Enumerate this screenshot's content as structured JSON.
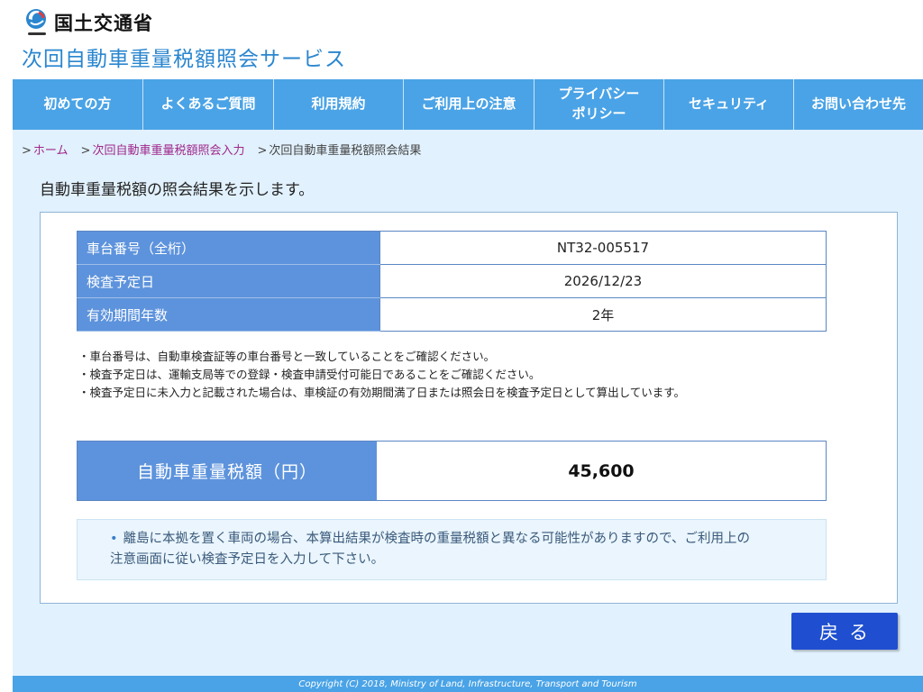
{
  "header": {
    "ministry_name": "国土交通省",
    "logo_icon": "mlit-logo-icon",
    "service_title": "次回自動車重量税額照会サービス"
  },
  "nav": {
    "items": [
      {
        "label": "初めての方"
      },
      {
        "label": "よくあるご質問"
      },
      {
        "label": "利用規約"
      },
      {
        "label": "ご利用上の注意"
      },
      {
        "label": "プライバシー\nポリシー"
      },
      {
        "label": "セキュリティ"
      },
      {
        "label": "お問い合わせ先"
      }
    ]
  },
  "breadcrumb": {
    "sep": ">",
    "home": "ホーム",
    "input": "次回自動車重量税額照会入力",
    "current": "次回自動車重量税額照会結果"
  },
  "lead": "自動車重量税額の照会結果を示します。",
  "info": {
    "rows": [
      {
        "label": "車台番号（全桁）",
        "value": "NT32-005517"
      },
      {
        "label": "検査予定日",
        "value": "2026/12/23"
      },
      {
        "label": "有効期間年数",
        "value": "2年"
      }
    ]
  },
  "notes": [
    "・車台番号は、自動車検査証等の車台番号と一致していることをご確認ください。",
    "・検査予定日は、運輸支局等での登録・検査申請受付可能日であることをご確認ください。",
    "・検査予定日に未入力と記載された場合は、車検証の有効期間満了日または照会日を検査予定日として算出しています。"
  ],
  "tax": {
    "label": "自動車重量税額（円）",
    "value": "45,600"
  },
  "notice": {
    "bullet": "•",
    "line1": "離島に本拠を置く車両の場合、本算出結果が検査時の重量税額と異なる可能性がありますので、ご利用上の",
    "line2": "注意画面に従い検査予定日を入力して下さい。"
  },
  "back_button": "戻る",
  "footer": "Copyright (C) 2018, Ministry of Land, Infrastructure, Transport and Tourism",
  "colors": {
    "nav_bg": "#4aa3e6",
    "main_bg": "#e1f1fd",
    "table_header_bg": "#5d93dc",
    "title_blue": "#2a86cf",
    "button_bg": "#1f4fd0",
    "breadcrumb_link": "#a0278a"
  }
}
